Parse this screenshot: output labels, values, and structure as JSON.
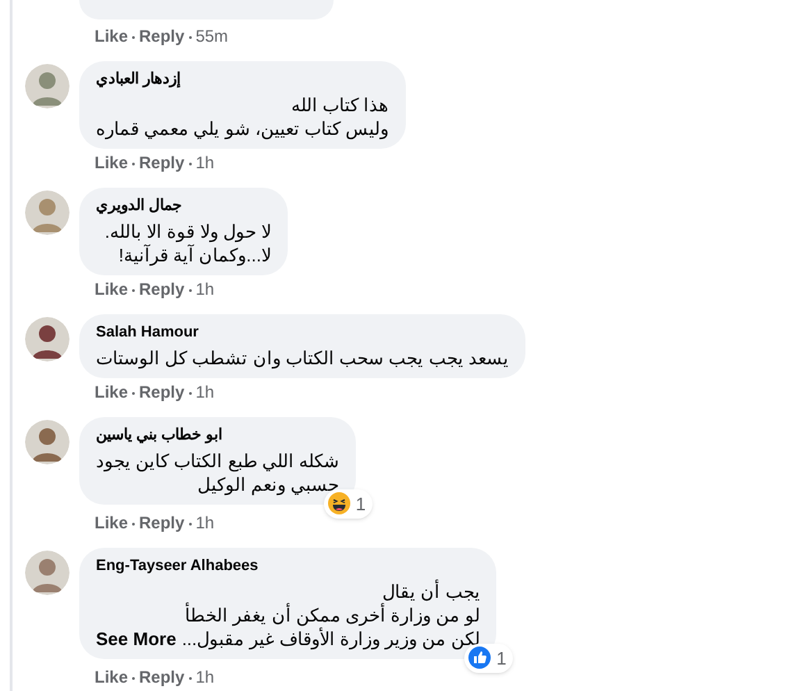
{
  "comments": [
    {
      "meta": {
        "like": "Like",
        "reply": "Reply",
        "time": "55m"
      }
    },
    {
      "author": "إزدهار العبادي",
      "lines": [
        "هذا كتاب الله",
        "وليس كتاب تعيين، شو يلي معمي قماره"
      ],
      "meta": {
        "like": "Like",
        "reply": "Reply",
        "time": "1h"
      }
    },
    {
      "author": "جمال الدويري",
      "lines": [
        "لا حول ولا قوة الا بالله.",
        "لا...وكمان آية قرآنية!"
      ],
      "meta": {
        "like": "Like",
        "reply": "Reply",
        "time": "1h"
      }
    },
    {
      "author": "Salah Hamour",
      "lines": [
        "يسعد يجب يجب سحب الكتاب وان تشطب كل الوستات"
      ],
      "meta": {
        "like": "Like",
        "reply": "Reply",
        "time": "1h"
      }
    },
    {
      "author": "ابو خطاب بني ياسين",
      "lines": [
        "شكله اللي طبع الكتاب كاين يجود",
        "حسبي ونعم الوكيل"
      ],
      "reaction": {
        "kind": "haha",
        "count": "1"
      },
      "meta": {
        "like": "Like",
        "reply": "Reply",
        "time": "1h"
      }
    },
    {
      "author": "Eng-Tayseer Alhabees",
      "lines": [
        "يجب أن يقال",
        "لو من وزارة أخرى ممكن أن يغفر الخطأ",
        "لكن من وزير وزارة الأوقاف غير مقبول..."
      ],
      "see_more": "See More",
      "reaction": {
        "kind": "like",
        "count": "1"
      },
      "meta": {
        "like": "Like",
        "reply": "Reply",
        "time": "1h"
      }
    }
  ]
}
